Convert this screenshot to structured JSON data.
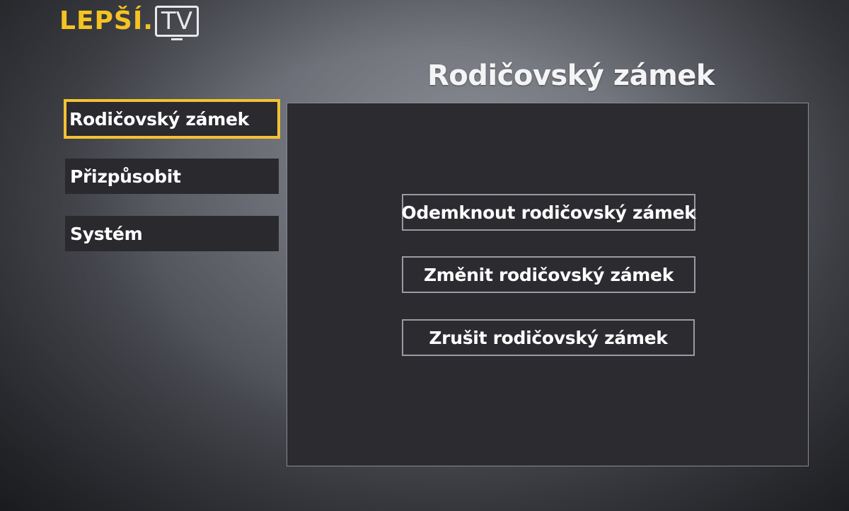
{
  "header": {
    "logo_left": "LEPŠÍ.",
    "logo_right": "TV",
    "title": "Rodičovský zámek"
  },
  "sidebar": {
    "items": [
      {
        "label": "Rodičovský zámek",
        "selected": true
      },
      {
        "label": "Přizpůsobit",
        "selected": false
      },
      {
        "label": "Systém",
        "selected": false
      }
    ]
  },
  "panel": {
    "actions": [
      {
        "label": "Odemknout rodičovský zámek"
      },
      {
        "label": "Změnit rodičovský zámek"
      },
      {
        "label": "Zrušit rodičovský zámek"
      }
    ]
  },
  "colors": {
    "accent": "#f3c233",
    "panel_bg": "#2c2b30",
    "text": "#ffffff"
  }
}
